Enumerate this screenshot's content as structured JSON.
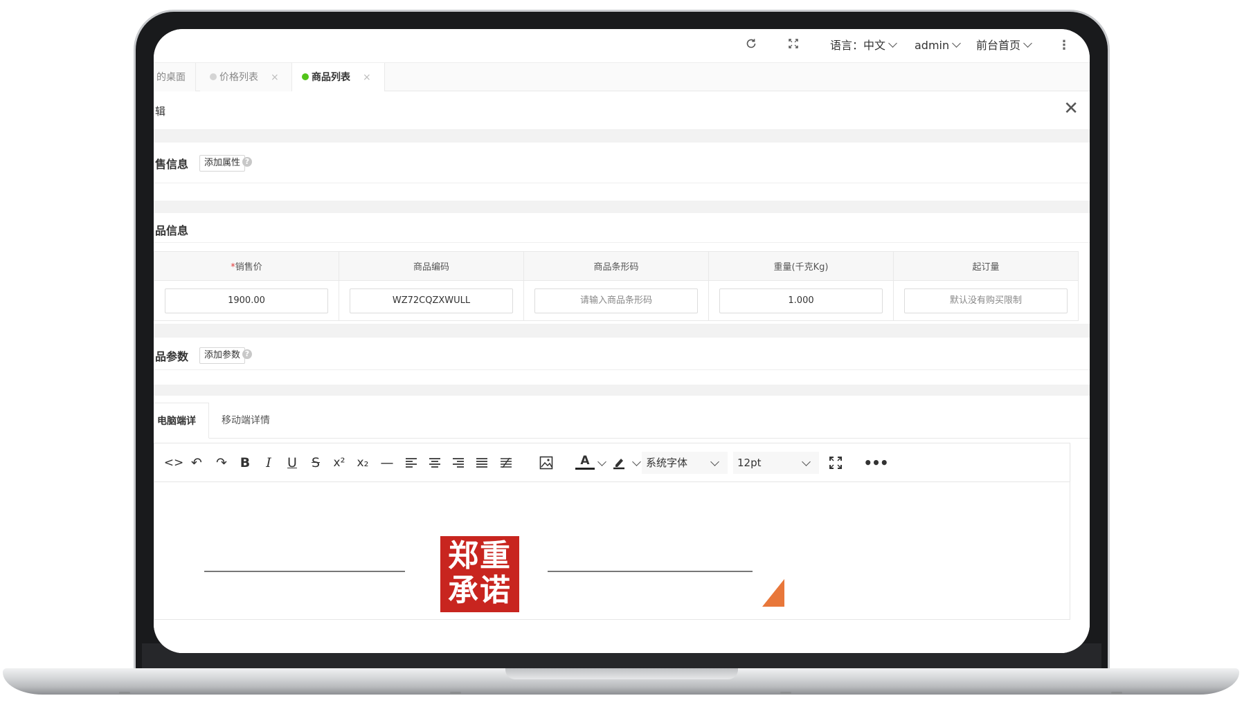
{
  "topbar": {
    "language_label": "语言：中文",
    "user": "admin",
    "frontend": "前台首页"
  },
  "tabs": [
    {
      "label": "我的桌面",
      "visible_text": "的桌面"
    },
    {
      "label": "价格列表",
      "close": "×"
    },
    {
      "label": "商品列表",
      "close": "×"
    }
  ],
  "dialog": {
    "title": "辑",
    "close": "✕"
  },
  "sections": {
    "sale_info": {
      "title": "售信息",
      "add_button": "添加属性"
    },
    "product_info": {
      "title": "品信息"
    },
    "params": {
      "title": "品参数",
      "add_button": "添加参数"
    }
  },
  "spec_table": {
    "required_mark": "*",
    "headers": [
      "销售价",
      "商品编码",
      "商品条形码",
      "重量(千克Kg)",
      "起订量"
    ],
    "values": [
      "1900.00",
      "WZ72CQZXWULL",
      "",
      "1.000",
      ""
    ],
    "placeholders": [
      "",
      "",
      "请输入商品条形码",
      "",
      "默认没有购买限制"
    ]
  },
  "editor": {
    "tabs": [
      "电脑端详情",
      "移动端详情"
    ],
    "font_family": "系统字体",
    "font_size": "12pt",
    "image_text": [
      "郑重",
      "承诺"
    ]
  },
  "colors": {
    "tab_active_dot": "#52c41a",
    "tab_inactive_dot": "#d4d4d4",
    "required": "#e23c3c",
    "seal": "#c8251f"
  }
}
